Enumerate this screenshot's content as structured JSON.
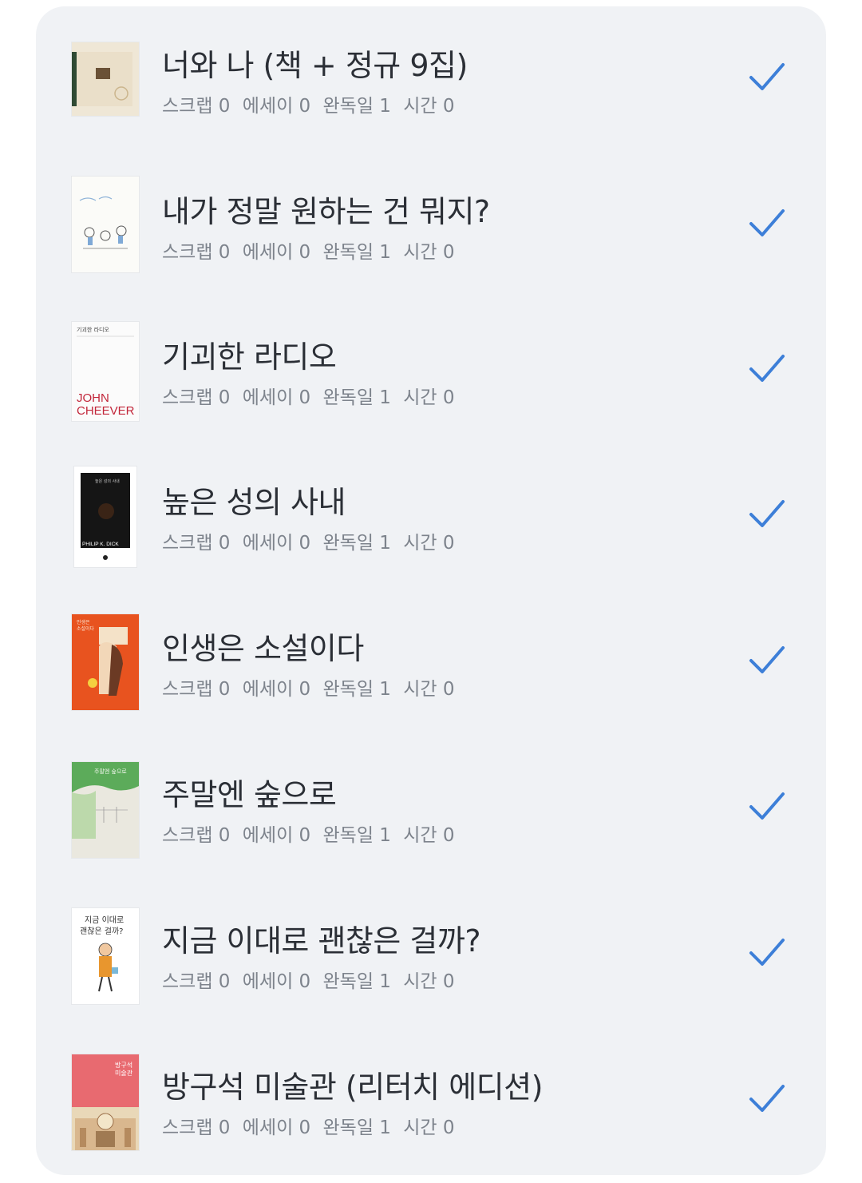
{
  "books": [
    {
      "title": "너와 나 (책 + 정규 9집)",
      "scrap": "스크랩 0",
      "essay": "에세이 0",
      "finished": "완독일 1",
      "time": "시간 0",
      "cover": "cover-minimal-beige"
    },
    {
      "title": "내가 정말 원하는 건 뭐지?",
      "scrap": "스크랩 0",
      "essay": "에세이 0",
      "finished": "완독일 1",
      "time": "시간 0",
      "cover": "cover-sketch-people"
    },
    {
      "title": "기괴한 라디오",
      "scrap": "스크랩 0",
      "essay": "에세이 0",
      "finished": "완독일 1",
      "time": "시간 0",
      "cover": "cover-john-cheever",
      "cover_text": [
        "기괴한 라디오",
        "JOHN",
        "CHEEVER"
      ]
    },
    {
      "title": "높은 성의 사내",
      "scrap": "스크랩 0",
      "essay": "에세이 0",
      "finished": "완독일 1",
      "time": "시간 0",
      "cover": "cover-philip-k-dick",
      "cover_text": [
        "높은 성의 사내",
        "PHILIP K. DICK"
      ]
    },
    {
      "title": "인생은 소설이다",
      "scrap": "스크랩 0",
      "essay": "에세이 0",
      "finished": "완독일 1",
      "time": "시간 0",
      "cover": "cover-orange-portrait",
      "cover_text": [
        "인생은",
        "소설이다"
      ]
    },
    {
      "title": "주말엔 숲으로",
      "scrap": "스크랩 0",
      "essay": "에세이 0",
      "finished": "완독일 1",
      "time": "시간 0",
      "cover": "cover-green-forest",
      "cover_text": [
        "주말엔 숲으로"
      ]
    },
    {
      "title": "지금 이대로 괜찮은 걸까?",
      "scrap": "스크랩 0",
      "essay": "에세이 0",
      "finished": "완독일 1",
      "time": "시간 0",
      "cover": "cover-boy-walking",
      "cover_text": [
        "지금 이대로",
        "괜찮은 걸까?"
      ]
    },
    {
      "title": "방구석 미술관 (리터치 에디션)",
      "scrap": "스크랩 0",
      "essay": "에세이 0",
      "finished": "완독일 1",
      "time": "시간 0",
      "cover": "cover-pink-museum",
      "cover_text": [
        "방구석",
        "미술관"
      ]
    }
  ],
  "colors": {
    "card_bg": "#f0f2f5",
    "title": "#2b2f36",
    "meta": "#7d838c",
    "check": "#3d7fd8"
  },
  "icons": {
    "check": "checkmark-icon"
  }
}
